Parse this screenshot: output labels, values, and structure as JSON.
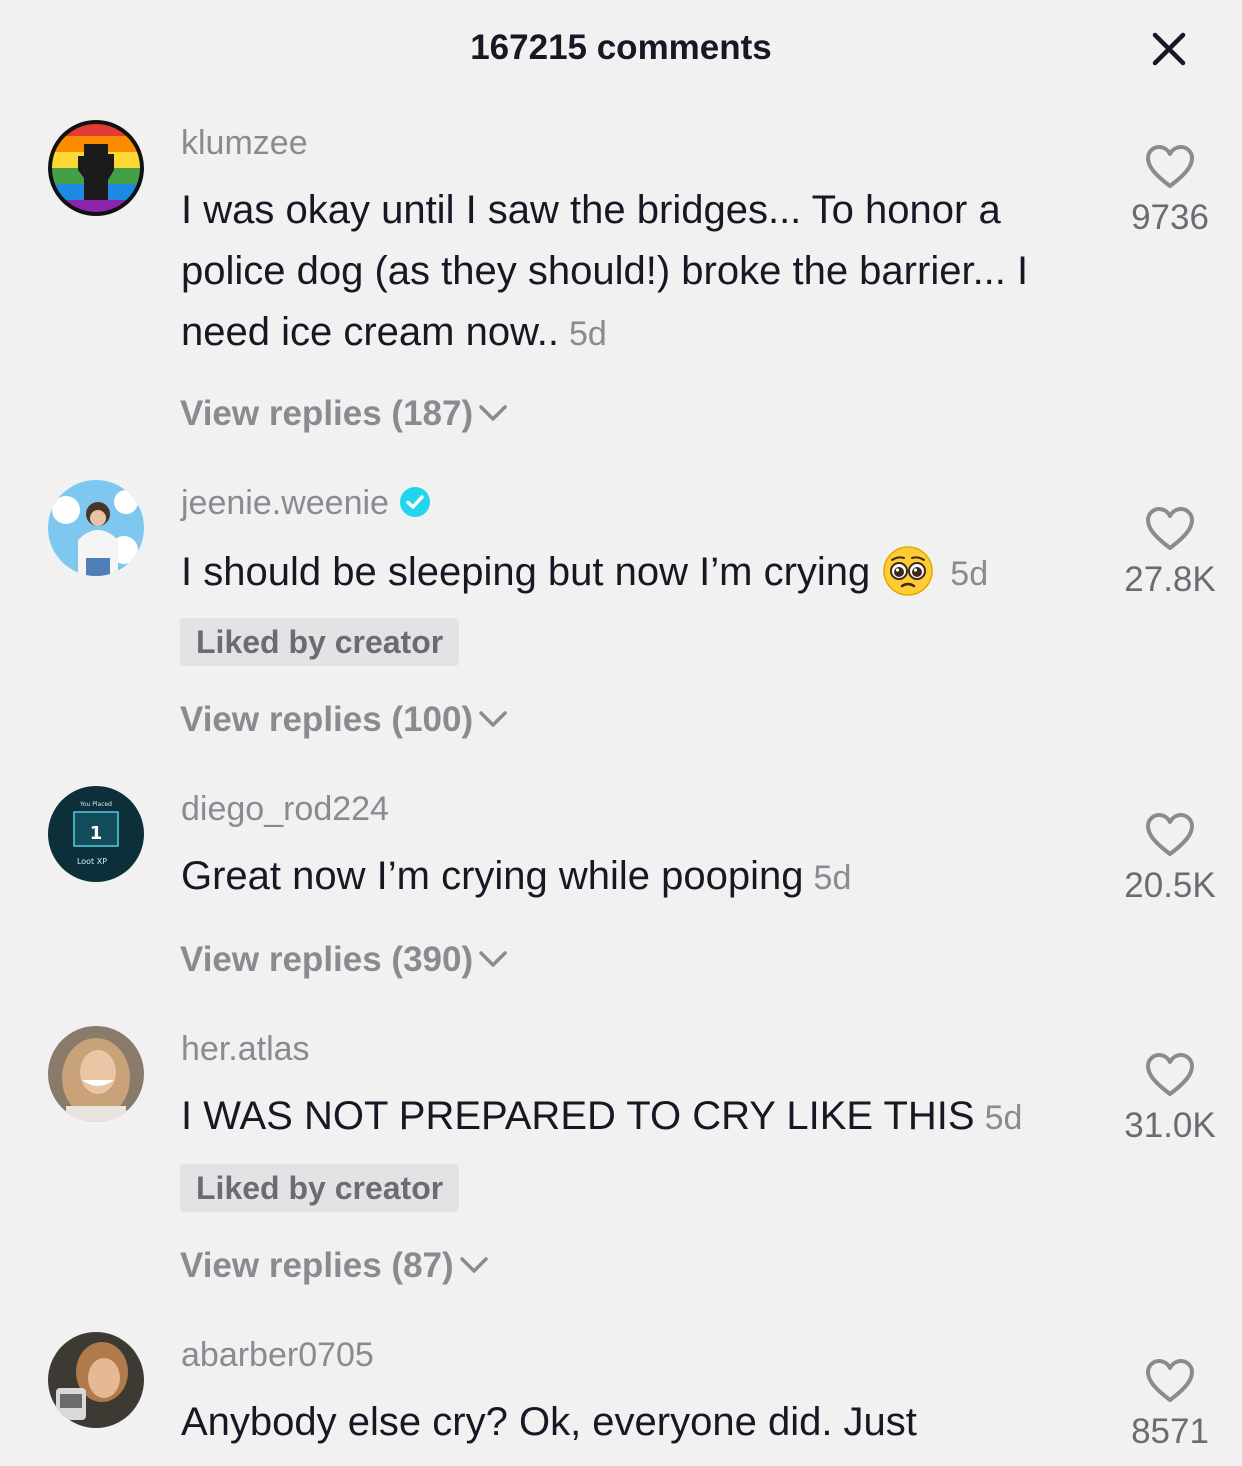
{
  "header": {
    "title": "167215 comments"
  },
  "comments": [
    {
      "username": "klumzee",
      "text": "I was okay until I saw the bridges... To honor a police dog (as they should!) broke the barrier... I need ice cream now..",
      "time": "5d",
      "likes": "9736",
      "replies": "View replies (187)",
      "liked_by_creator": "",
      "verified": false
    },
    {
      "username": "jeenie.weenie",
      "text": "I should be sleeping but now I’m crying",
      "emoji": "pleading-face-emoji",
      "time": "5d",
      "likes": "27.8K",
      "replies": "View replies (100)",
      "liked_by_creator": "Liked by creator",
      "verified": true
    },
    {
      "username": "diego_rod224",
      "text": "Great now I’m crying while pooping",
      "time": "5d",
      "likes": "20.5K",
      "replies": "View replies (390)",
      "liked_by_creator": "",
      "verified": false
    },
    {
      "username": "her.atlas",
      "text": "I WAS NOT PREPARED TO CRY LIKE THIS",
      "time": "5d",
      "likes": "31.0K",
      "replies": "View replies (87)",
      "liked_by_creator": "Liked by creator",
      "verified": false
    },
    {
      "username": "abarber0705",
      "text": "Anybody else cry? Ok, everyone did. Just",
      "time": "",
      "likes": "8571",
      "replies": "",
      "liked_by_creator": "",
      "verified": false
    }
  ],
  "icons": {
    "close": "close-icon",
    "heart": "heart-outline-icon",
    "chevron": "chevron-down-icon",
    "verified": "verified-badge-icon"
  },
  "colors": {
    "background": "#f1f1f2",
    "primary_text": "#161823",
    "secondary_text": "#8a8b91",
    "verified": "#20d5ec"
  }
}
